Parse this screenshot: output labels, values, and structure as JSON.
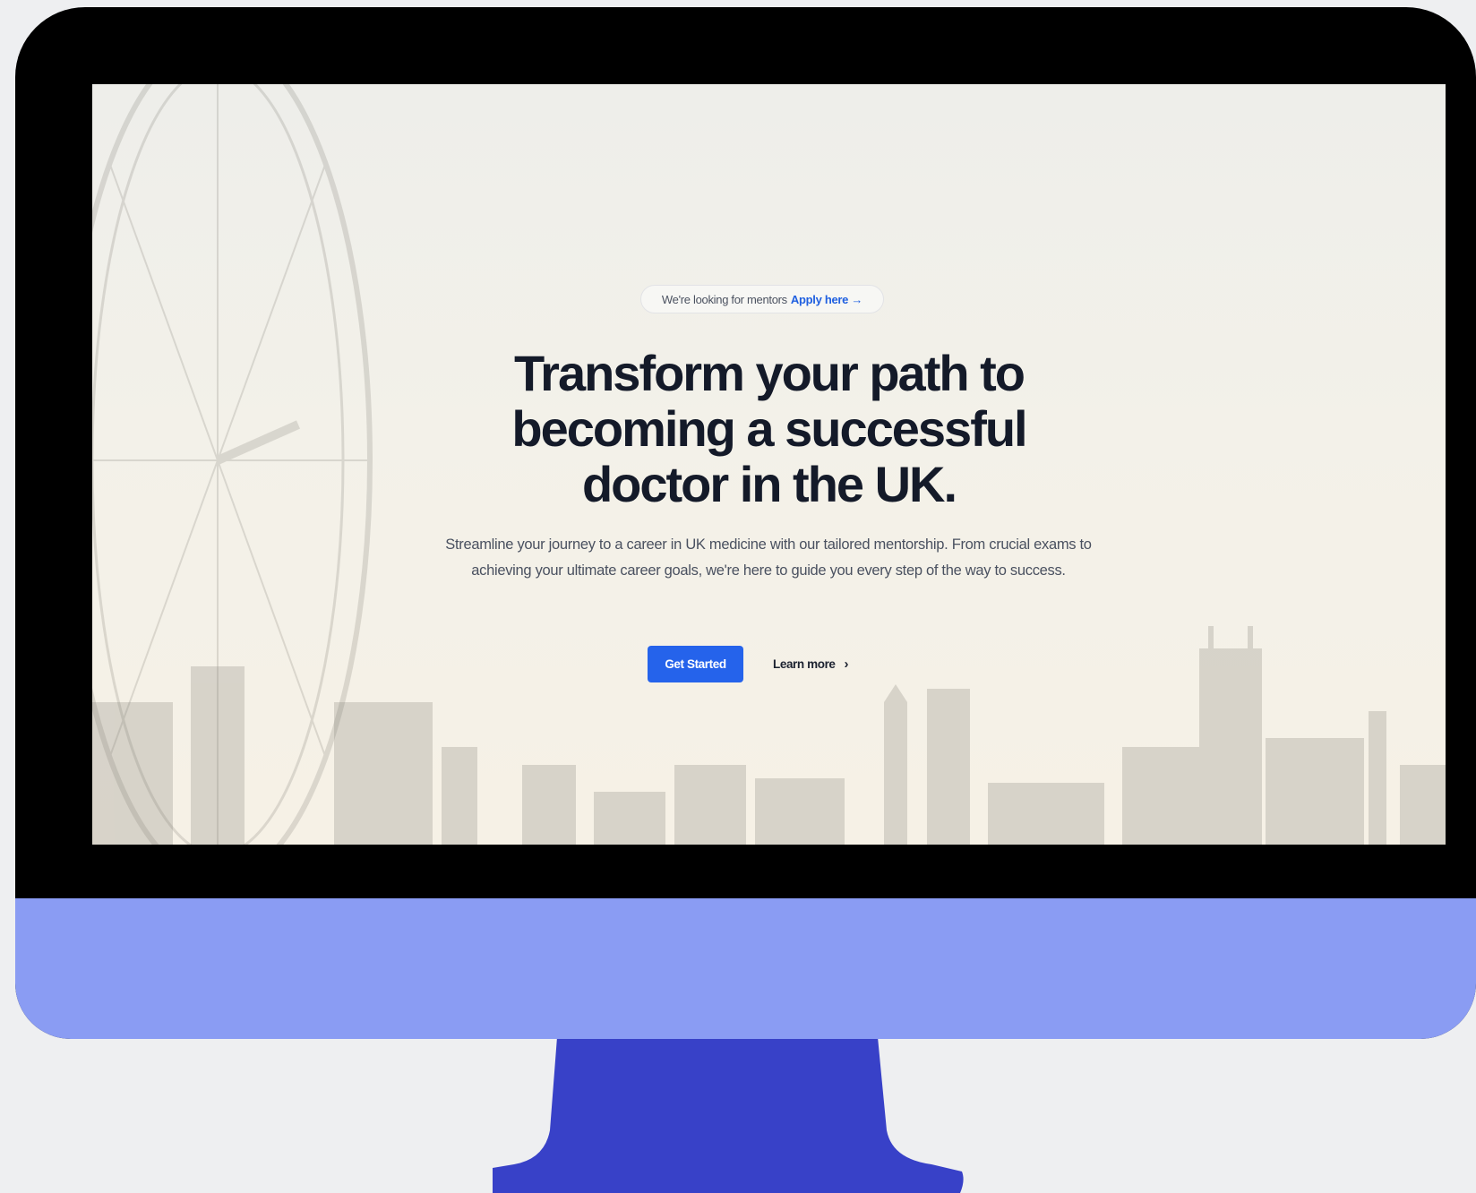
{
  "banner": {
    "text": "We're looking for mentors",
    "link_label": "Apply here →"
  },
  "hero": {
    "headline_lines": [
      "Transform your path to",
      "becoming a successful",
      "doctor in the UK."
    ],
    "description": "Streamline your journey to a career in UK medicine with our tailored mentorship. From crucial exams to achieving your ultimate career goals, we're here to guide you every step of the way to success.",
    "primary_cta": "Get Started",
    "secondary_cta": "Learn more"
  },
  "icons": {
    "secondary_cta_icon": "chevron-right-icon",
    "background": "london-skyline-with-ferris-wheel"
  },
  "colors": {
    "accent": "#2563eb",
    "link": "#2060e0",
    "headline": "#141a29",
    "monitor_frame": "#000000",
    "monitor_chin": "#8a9cf3",
    "monitor_stand": "#3841c8",
    "page_background": "#eeeff1"
  }
}
